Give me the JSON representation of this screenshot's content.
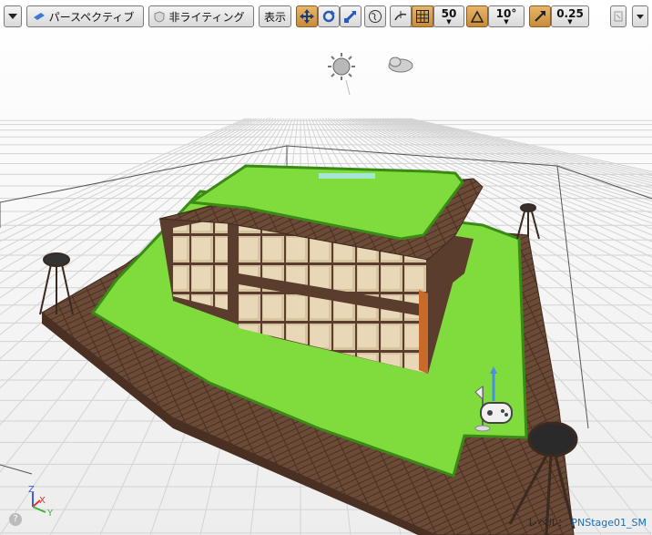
{
  "toolbar": {
    "perspective_label": "パースペクティブ",
    "lighting_label": "非ライティング",
    "show_label": "表示",
    "grid_snap_value": "50",
    "rotate_snap_value": "10°",
    "scale_snap_value": "0.25"
  },
  "status": {
    "level_label": "レベル：",
    "level_name": "PNStage01_SM"
  },
  "axis": {
    "z": "Z",
    "x": "X",
    "y": "Y"
  },
  "colors": {
    "grass": "#7fdc3c",
    "wood": "#6b4a37",
    "active_orange": "#d49a48",
    "axis_x": "#e03030",
    "axis_y": "#3bb33b",
    "axis_z": "#3a5be8"
  },
  "icons": [
    "menu-dropdown-icon",
    "perspective-icon",
    "shield-icon",
    "move-icon",
    "rotate-icon",
    "scale-icon",
    "world-icon",
    "surface-snap-icon",
    "grid-icon",
    "angle-icon",
    "scale-snap-icon",
    "maximize-icon",
    "help-icon",
    "sun-icon",
    "cloud-icon",
    "player-start-icon"
  ]
}
